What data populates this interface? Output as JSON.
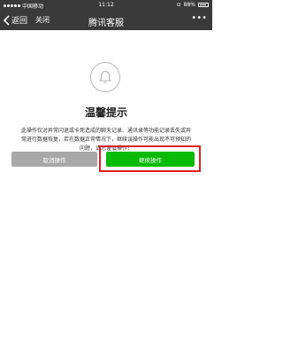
{
  "status_bar": {
    "carrier": "中国移动",
    "network": "",
    "time": "11:12",
    "battery": "88%"
  },
  "nav": {
    "back_label": "返回",
    "close_label": "关闭",
    "title": "腾讯客服",
    "more_label": "•••"
  },
  "dialog": {
    "icon": "bell-icon",
    "heading": "温馨提示",
    "message": "此操作仅对异常闪退或卡死造成的聊天记录、通讯录等功能记录丢失或异常进行数据恢复，若在数据正常情况下，继续误操作可能出现不可预知的问题，请您谨慎操作！",
    "cancel_label": "取消操作",
    "continue_label": "继续操作"
  },
  "colors": {
    "nav_background": "#3a3a3a",
    "primary_button": "#09bb07",
    "secondary_button": "#a8a8a8",
    "annotation_box": "#e02020"
  }
}
